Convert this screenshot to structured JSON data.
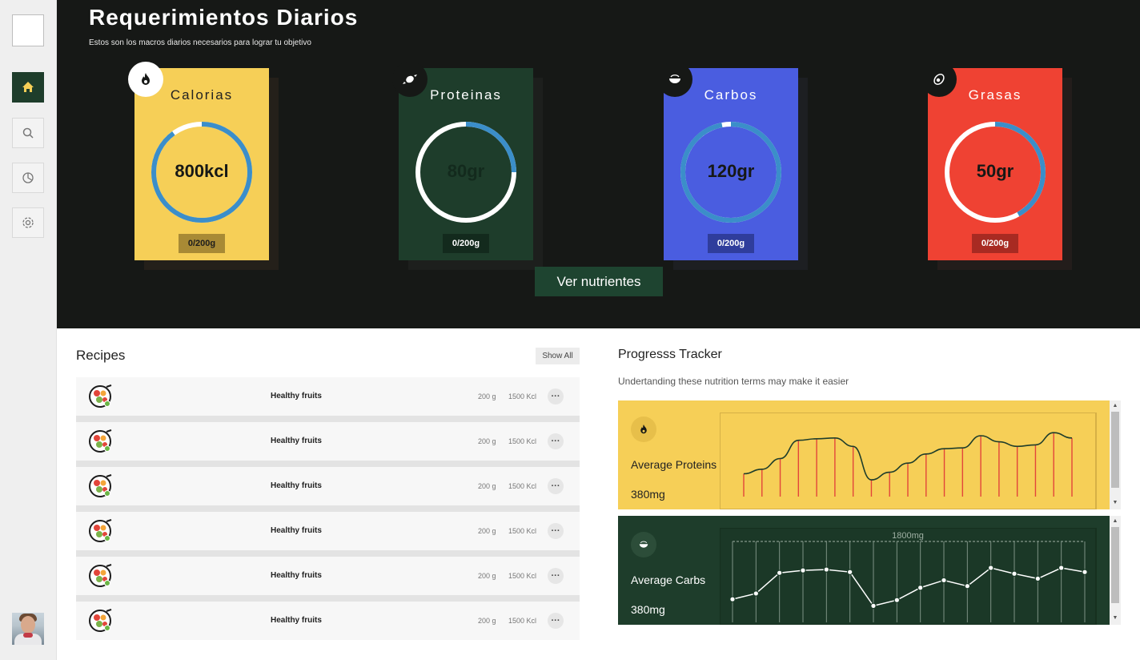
{
  "hero": {
    "title": "Requerimientos Diarios",
    "subtitle": "Estos son los macros diarios necesarios para lograr tu objetivo",
    "button_label": "Ver nutrientes"
  },
  "cards": [
    {
      "title": "Calorias",
      "value": "800kcl",
      "badge": "0/200g",
      "icon": "flame-icon",
      "progress": 0.9,
      "color": "#f6cf57"
    },
    {
      "title": "Proteinas",
      "value": "80gr",
      "badge": "0/200g",
      "icon": "candy-icon",
      "progress": 0.25,
      "color": "#1e3d2b"
    },
    {
      "title": "Carbos",
      "value": "120gr",
      "badge": "0/200g",
      "icon": "bowl-icon",
      "progress": 0.97,
      "color": "#4a5de0"
    },
    {
      "title": "Grasas",
      "value": "50gr",
      "badge": "0/200g",
      "icon": "avocado-icon",
      "progress": 0.42,
      "color": "#ef4233"
    }
  ],
  "recipes": {
    "title": "Recipes",
    "show_all": "Show All",
    "items": [
      {
        "name": "Healthy fruits",
        "weight": "200 g",
        "kcal": "1500 Kcl"
      },
      {
        "name": "Healthy fruits",
        "weight": "200 g",
        "kcal": "1500 Kcl"
      },
      {
        "name": "Healthy fruits",
        "weight": "200 g",
        "kcal": "1500 Kcl"
      },
      {
        "name": "Healthy fruits",
        "weight": "200 g",
        "kcal": "1500 Kcl"
      },
      {
        "name": "Healthy fruits",
        "weight": "200 g",
        "kcal": "1500 Kcl"
      },
      {
        "name": "Healthy fruits",
        "weight": "200 g",
        "kcal": "1500 Kcl"
      }
    ]
  },
  "tracker": {
    "title": "Progresss Tracker",
    "subtitle": "Undertanding these nutrition terms may make it easier",
    "panels": [
      {
        "label": "Average Proteins",
        "value": "380mg",
        "icon": "flame-icon"
      },
      {
        "label": "Average Carbs",
        "value": "380mg",
        "icon": "bowl-icon",
        "reference_label": "1800mg"
      }
    ]
  },
  "chart_data": [
    {
      "type": "line",
      "values": [
        30,
        36,
        50,
        74,
        76,
        77,
        66,
        22,
        32,
        44,
        56,
        63,
        64,
        80,
        72,
        66,
        68,
        84,
        77
      ],
      "ylim": [
        0,
        100
      ]
    },
    {
      "type": "line",
      "values": [
        28,
        35,
        60,
        63,
        64,
        61,
        20,
        27,
        42,
        51,
        44,
        66,
        59,
        53,
        66,
        61
      ],
      "reference": 1800,
      "ylim": [
        0,
        100
      ]
    }
  ]
}
